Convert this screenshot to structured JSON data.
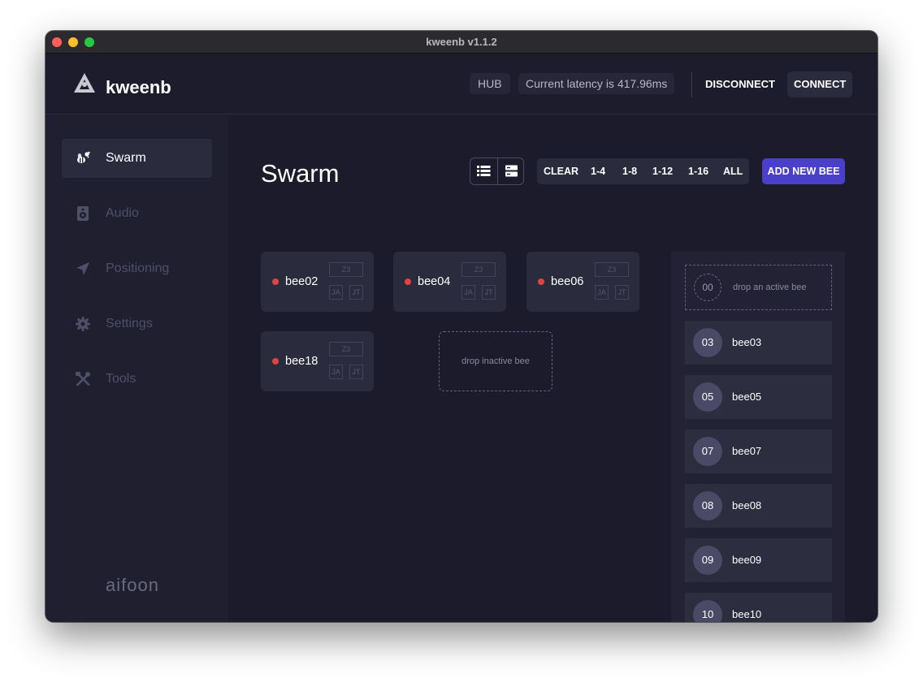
{
  "window": {
    "title": "kweenb v1.1.2"
  },
  "header": {
    "logo_text": "kweenb",
    "hub_label": "HUB",
    "latency_text": "Current latency is 417.96ms",
    "disconnect_label": "DISCONNECT",
    "connect_label": "CONNECT"
  },
  "sidebar": {
    "items": [
      {
        "label": "Swarm",
        "icon": "bees-icon",
        "active": true
      },
      {
        "label": "Audio",
        "icon": "speaker-icon",
        "active": false
      },
      {
        "label": "Positioning",
        "icon": "location-arrow-icon",
        "active": false
      },
      {
        "label": "Settings",
        "icon": "gear-icon",
        "active": false
      },
      {
        "label": "Tools",
        "icon": "tools-icon",
        "active": false
      }
    ],
    "brand": "aifoon"
  },
  "main": {
    "title": "Swarm",
    "filters": [
      "CLEAR",
      "1-4",
      "1-8",
      "1-12",
      "1-16",
      "ALL"
    ],
    "add_label": "ADD NEW BEE",
    "inactive_bees": [
      {
        "name": "bee02",
        "tags": [
          "Z3",
          "JA",
          "JT"
        ]
      },
      {
        "name": "bee04",
        "tags": [
          "Z3",
          "JA",
          "JT"
        ]
      },
      {
        "name": "bee06",
        "tags": [
          "Z3",
          "JA",
          "JT"
        ]
      },
      {
        "name": "bee18",
        "tags": [
          "Z3",
          "JA",
          "JT"
        ]
      }
    ],
    "drop_inactive_text": "drop inactive bee",
    "drop_active": {
      "number": "00",
      "text": "drop an active bee"
    },
    "active_bees": [
      {
        "number": "03",
        "name": "bee03"
      },
      {
        "number": "05",
        "name": "bee05"
      },
      {
        "number": "07",
        "name": "bee07"
      },
      {
        "number": "08",
        "name": "bee08"
      },
      {
        "number": "09",
        "name": "bee09"
      },
      {
        "number": "10",
        "name": "bee10"
      }
    ]
  },
  "colors": {
    "accent": "#4a3fc9",
    "status_inactive": "#e2433f",
    "background": "#1b1b2b"
  }
}
